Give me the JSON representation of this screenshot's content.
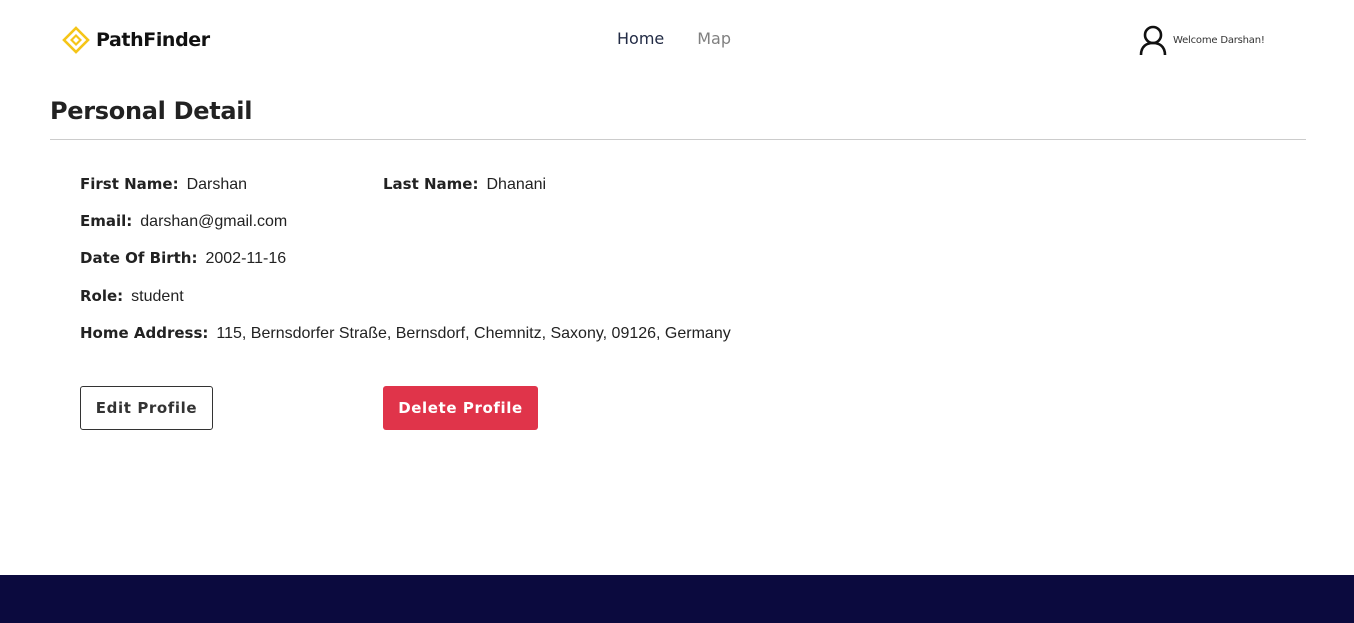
{
  "brand": {
    "name": "PathFinder",
    "logo_icon": "diamond-logo-icon",
    "logo_color": "#f5c518"
  },
  "nav": {
    "items": [
      {
        "label": "Home"
      },
      {
        "label": "Map"
      }
    ]
  },
  "user": {
    "icon": "user-icon",
    "welcome_text": "Welcome Darshan!"
  },
  "page": {
    "title": "Personal Detail"
  },
  "profile": {
    "first_name": {
      "label": "First Name:",
      "value": "Darshan"
    },
    "last_name": {
      "label": "Last Name:",
      "value": "Dhanani"
    },
    "email": {
      "label": "Email:",
      "value": "darshan@gmail.com"
    },
    "dob": {
      "label": "Date Of Birth:",
      "value": "2002-11-16"
    },
    "role": {
      "label": "Role:",
      "value": "student"
    },
    "address": {
      "label": "Home Address:",
      "value": "115, Bernsdorfer Straße, Bernsdorf, Chemnitz, Saxony, 09126, Germany"
    }
  },
  "actions": {
    "edit_label": "Edit Profile",
    "delete_label": "Delete Profile"
  },
  "colors": {
    "accent_red": "#e0344a",
    "footer_navy": "#0b0a3e",
    "nav_active": "#222b45",
    "nav_inactive": "#808080"
  }
}
